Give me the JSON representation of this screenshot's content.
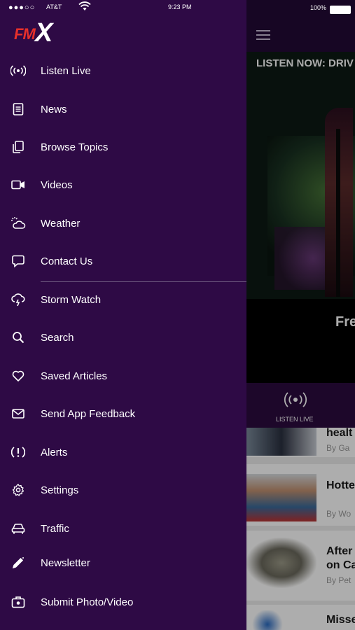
{
  "status_bar": {
    "signal": "●●●○○",
    "carrier": "AT&T",
    "time": "9:23 PM",
    "battery": "100%"
  },
  "brand": {
    "logo_text_1": "FM",
    "logo_text_2": "X"
  },
  "menu": [
    {
      "label": "Listen Live",
      "icon": "broadcast-icon"
    },
    {
      "label": "News",
      "icon": "document-icon"
    },
    {
      "label": "Browse Topics",
      "icon": "copy-icon"
    },
    {
      "label": "Videos",
      "icon": "video-camera-icon"
    },
    {
      "label": "Weather",
      "icon": "cloud-sun-icon"
    },
    {
      "label": "Contact Us",
      "icon": "chat-bubble-icon"
    },
    {
      "label": "Storm Watch",
      "icon": "storm-icon"
    },
    {
      "label": "Search",
      "icon": "search-icon"
    },
    {
      "label": "Saved Articles",
      "icon": "heart-icon"
    },
    {
      "label": "Send App Feedback",
      "icon": "mail-icon"
    },
    {
      "label": "Alerts",
      "icon": "alert-icon"
    },
    {
      "label": "Settings",
      "icon": "gear-icon"
    },
    {
      "label": "Traffic",
      "icon": "car-icon"
    },
    {
      "label": "Newsletter",
      "icon": "pencil-icon"
    },
    {
      "label": "Submit Photo/Video",
      "icon": "camera-bag-icon"
    }
  ],
  "main": {
    "hero_banner": "LISTEN NOW: DRIV",
    "hero_title": "Fre",
    "listen_live_label": "LISTEN LIVE",
    "articles": [
      {
        "title": "healt",
        "byline": "By Ga"
      },
      {
        "title": "Hotte",
        "byline": "By Wo"
      },
      {
        "title_line1": "After",
        "title_line2": "on Ca",
        "byline": "By Pet"
      },
      {
        "title": "Misse"
      }
    ]
  },
  "colors": {
    "sidebar_bg": "#2e0a45",
    "logo_red": "#e5302b",
    "header_bg": "#220935"
  }
}
